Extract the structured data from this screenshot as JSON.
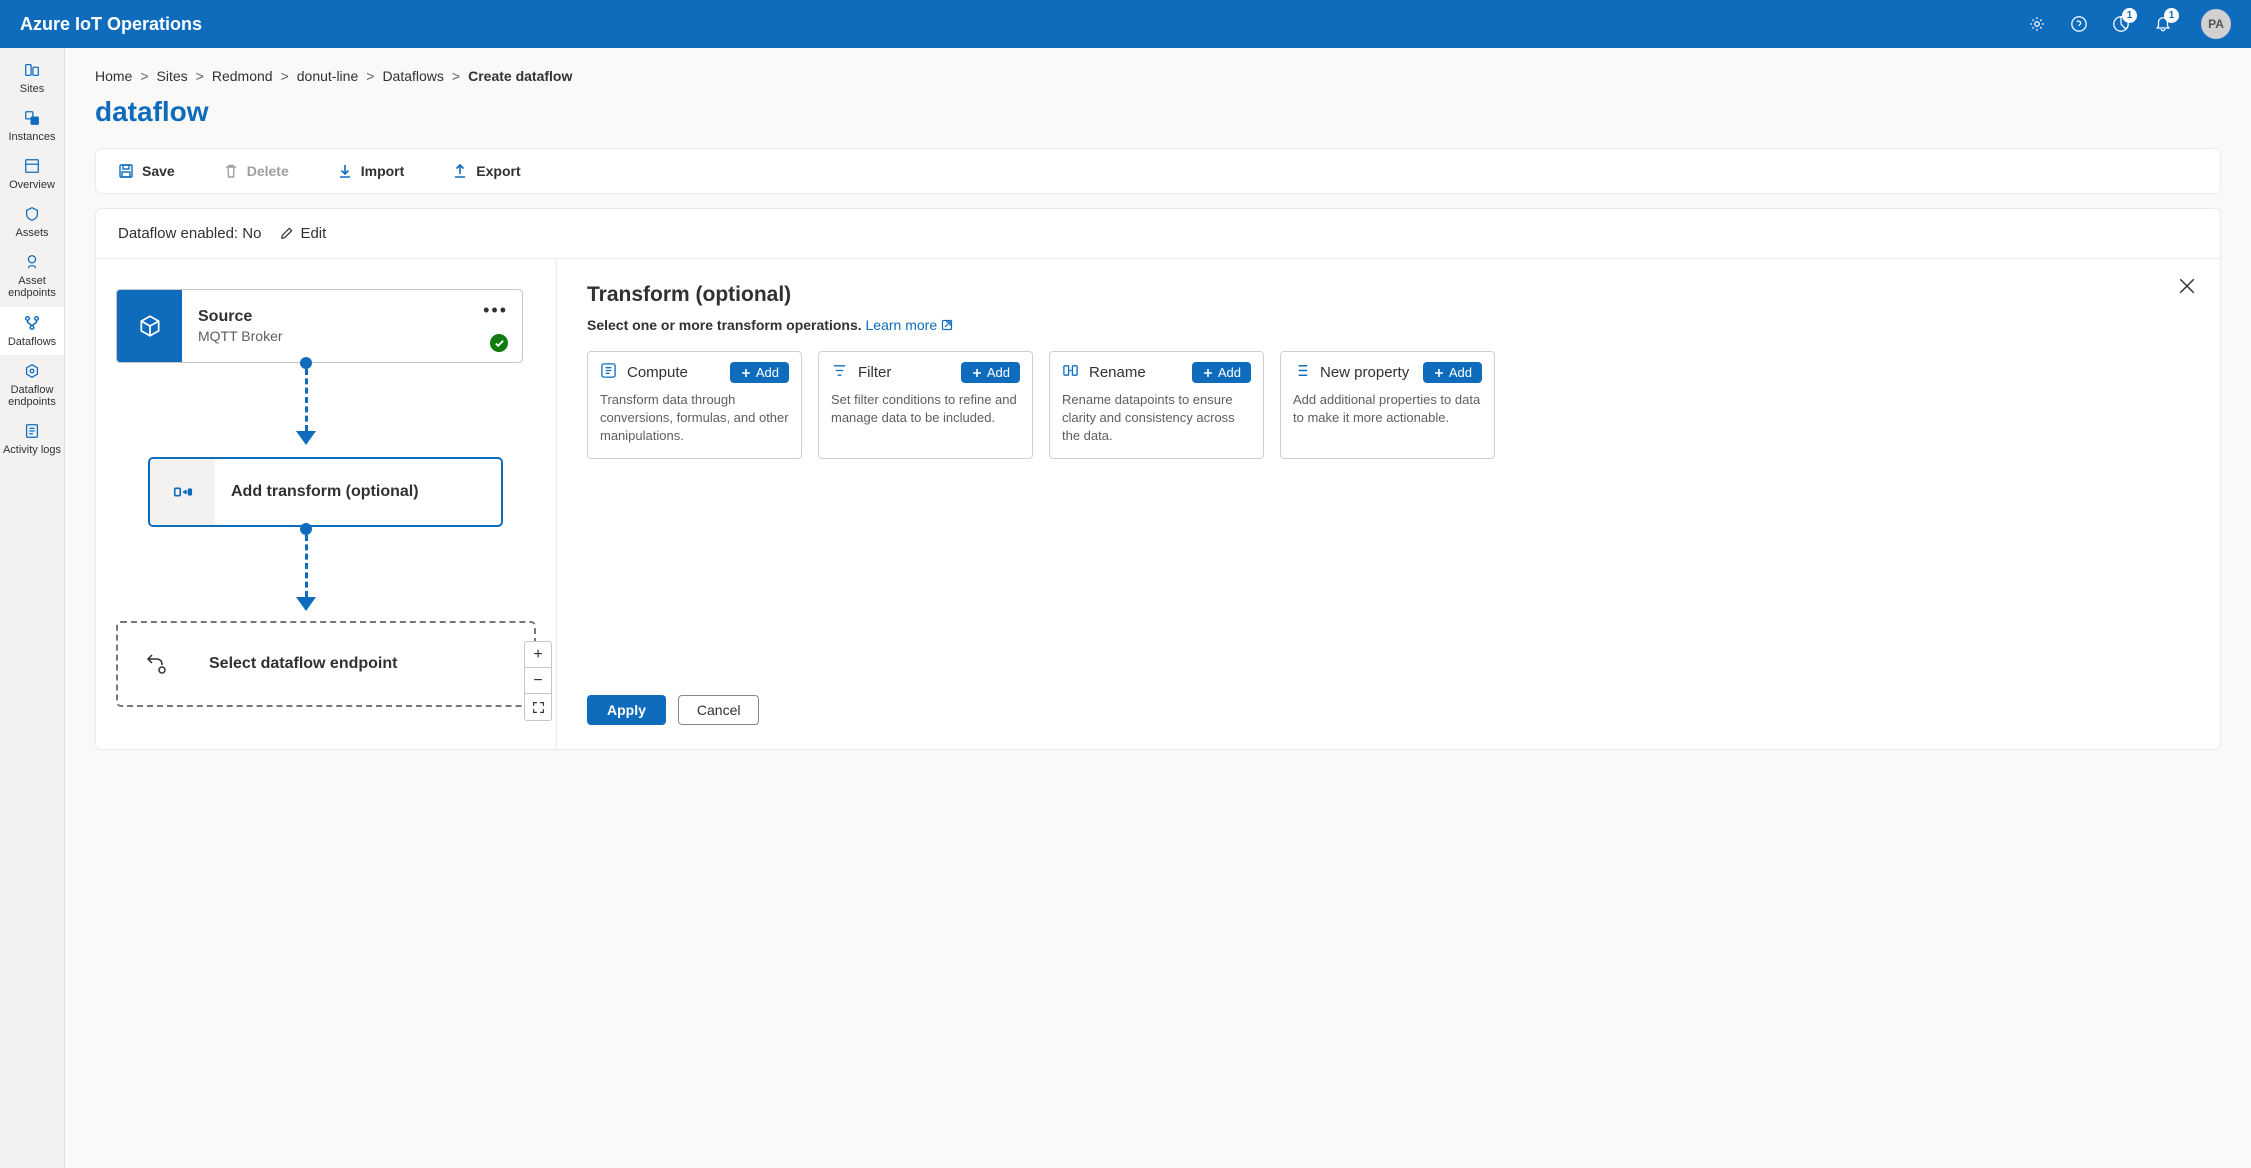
{
  "header": {
    "title": "Azure IoT Operations",
    "badge1": "1",
    "badge2": "1",
    "avatar": "PA"
  },
  "sidebar": {
    "items": [
      {
        "label": "Sites"
      },
      {
        "label": "Instances"
      },
      {
        "label": "Overview"
      },
      {
        "label": "Assets"
      },
      {
        "label": "Asset endpoints"
      },
      {
        "label": "Dataflows"
      },
      {
        "label": "Dataflow endpoints"
      },
      {
        "label": "Activity logs"
      }
    ]
  },
  "breadcrumb": {
    "items": [
      "Home",
      "Sites",
      "Redmond",
      "donut-line",
      "Dataflows"
    ],
    "current": "Create dataflow"
  },
  "page_title": "dataflow",
  "toolbar": {
    "save": "Save",
    "delete": "Delete",
    "import": "Import",
    "export": "Export"
  },
  "status": {
    "label": "Dataflow enabled: No",
    "edit": "Edit"
  },
  "canvas": {
    "source": {
      "title": "Source",
      "subtitle": "MQTT Broker"
    },
    "transform": {
      "title": "Add transform (optional)"
    },
    "endpoint": {
      "title": "Select dataflow endpoint"
    }
  },
  "detail": {
    "title": "Transform (optional)",
    "hint": "Select one or more transform operations.",
    "learn_more": "Learn more",
    "add_label": "Add",
    "cards": [
      {
        "title": "Compute",
        "desc": "Transform data through conversions, formulas, and other manipulations."
      },
      {
        "title": "Filter",
        "desc": "Set filter conditions to refine and manage data to be included."
      },
      {
        "title": "Rename",
        "desc": "Rename datapoints to ensure clarity and consistency across the data."
      },
      {
        "title": "New property",
        "desc": "Add additional properties to data to make it more actionable."
      }
    ],
    "apply": "Apply",
    "cancel": "Cancel"
  }
}
